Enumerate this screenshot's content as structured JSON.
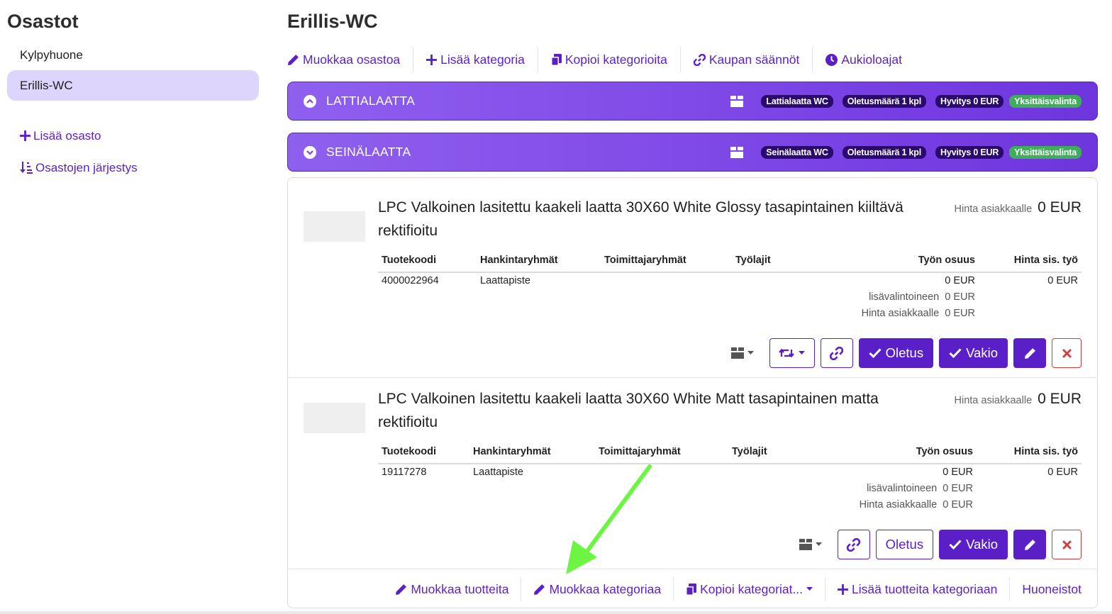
{
  "sidebar": {
    "title": "Osastot",
    "items": [
      {
        "label": "Kylpyhuone",
        "active": false
      },
      {
        "label": "Erillis-WC",
        "active": true
      }
    ],
    "add_label": "Lisää osasto",
    "order_label": "Osastojen järjestys"
  },
  "main": {
    "title": "Erillis-WC",
    "toolbar": {
      "edit": "Muokkaa osastoa",
      "add_category": "Lisää kategoria",
      "copy_categories": "Kopioi kategorioita",
      "rules": "Kaupan säännöt",
      "hours": "Aukioloajat"
    },
    "categories": [
      {
        "name": "LATTIALAATTA",
        "state": "collapsed",
        "badges": [
          "Lattialaatta WC",
          "Oletusmäärä 1 kpl",
          "Hyvitys 0 EUR",
          "Yksittäisvalinta"
        ]
      },
      {
        "name": "SEINÄLAATTA",
        "state": "expanded",
        "badges": [
          "Seinälaatta WC",
          "Oletusmäärä 1 kpl",
          "Hyvitys 0 EUR",
          "Yksittäisvalinta"
        ]
      }
    ],
    "products": [
      {
        "title": "LPC Valkoinen lasitettu kaakeli laatta 30X60 White Glossy tasapintainen kiiltävä rektifioitu",
        "price_label": "Hinta asiakkaalle",
        "price": "0 EUR",
        "columns": [
          "Tuotekoodi",
          "Hankintaryhmät",
          "Toimittajaryhmät",
          "Työlajit",
          "Työn osuus",
          "Hinta sis. työ"
        ],
        "code": "4000022964",
        "procurement": "Laattapiste",
        "work_share": "0 EUR",
        "price_incl_work": "0 EUR",
        "extras_label": "lisävalintoineen",
        "extras_value": "0 EUR",
        "customer_label": "Hinta asiakkaalle",
        "customer_value": "0 EUR",
        "btn_default": "Oletus",
        "btn_standard": "Vakio"
      },
      {
        "title": "LPC Valkoinen lasitettu kaakeli laatta 30X60 White Matt tasapintainen matta rektifioitu",
        "price_label": "Hinta asiakkaalle",
        "price": "0 EUR",
        "columns": [
          "Tuotekoodi",
          "Hankintaryhmät",
          "Toimittajaryhmät",
          "Työlajit",
          "Työn osuus",
          "Hinta sis. työ"
        ],
        "code": "19117278",
        "procurement": "Laattapiste",
        "work_share": "0 EUR",
        "price_incl_work": "0 EUR",
        "extras_label": "lisävalintoineen",
        "extras_value": "0 EUR",
        "customer_label": "Hinta asiakkaalle",
        "customer_value": "0 EUR",
        "btn_default": "Oletus",
        "btn_standard": "Vakio"
      }
    ],
    "footer": {
      "edit_products": "Muokkaa tuotteita",
      "edit_category": "Muokkaa kategoriaa",
      "copy_categories": "Kopioi kategoriat...",
      "add_products": "Lisää tuotteita kategoriaan",
      "apartments": "Huoneistot"
    }
  },
  "colors": {
    "accent": "#5b1fc7",
    "category_bar": "#7c45e6",
    "badge_dark": "#2a0a6e",
    "badge_green": "#3fae5a",
    "danger": "#d23c3c",
    "annotation_arrow": "#6cf542"
  }
}
